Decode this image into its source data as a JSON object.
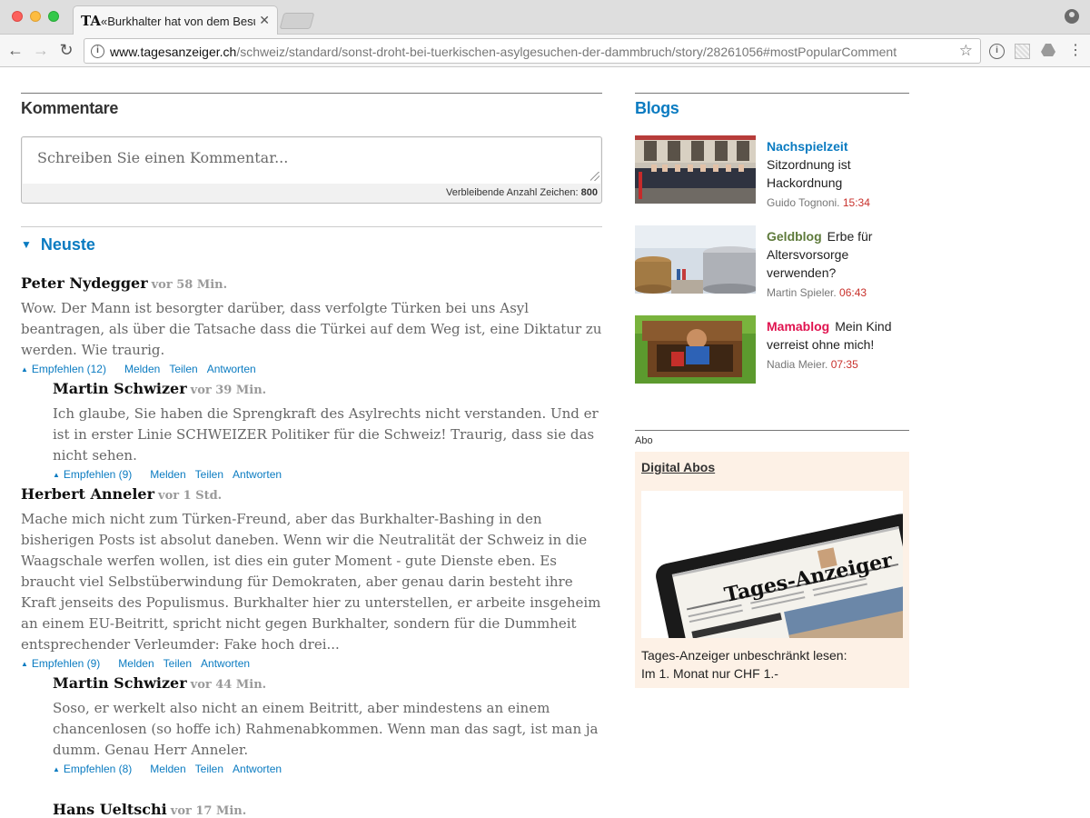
{
  "browser": {
    "tab_title": "«Burkhalter hat von dem Besu",
    "tab_close_icon": "close-icon",
    "url_host": "www.tagesanzeiger.ch",
    "url_path": "/schweiz/standard/sonst-droht-bei-tuerkischen-asylgesuchen-der-dammbruch/story/28261056#mostPopularComment"
  },
  "comments_section": {
    "title": "Kommentare",
    "placeholder": "Schreiben Sie einen Kommentar...",
    "counter_label": "Verbleibende Anzahl Zeichen:",
    "counter_value": "800",
    "sort_label": "Neuste"
  },
  "actions": {
    "reply": "Antworten",
    "report": "Melden",
    "share": "Teilen"
  },
  "comments": [
    {
      "author": "Peter Nydegger",
      "time": "vor 58 Min.",
      "text": "Wow. Der Mann ist besorgter darüber, dass verfolgte Türken bei uns Asyl beantragen, als über die Tatsache dass die Türkei auf dem Weg ist, eine Diktatur zu werden. Wie traurig.",
      "recommend": "Empfehlen (12)"
    },
    {
      "author": "Martin Schwizer",
      "time": "vor 39 Min.",
      "text": "Ich glaube, Sie haben die Sprengkraft des Asylrechts nicht verstanden. Und er ist in erster Linie SCHWEIZER Politiker für die Schweiz! Traurig, dass sie das nicht sehen.",
      "recommend": "Empfehlen (9)"
    },
    {
      "author": "Herbert Anneler",
      "time": "vor 1 Std.",
      "text": "Mache mich nicht zum Türken-Freund, aber das Burkhalter-Bashing in den bisherigen Posts ist absolut daneben. Wenn wir die Neutralität der Schweiz in die Waagschale werfen wollen, ist dies ein guter Moment - gute Dienste eben. Es braucht viel Selbstüberwindung für Demokraten, aber genau darin besteht ihre Kraft jenseits des Populismus. Burkhalter hier zu unterstellen, er arbeite insgeheim an einem EU-Beitritt, spricht nicht gegen Burkhalter, sondern für die Dummheit entsprechender Verleumder: Fake hoch drei...",
      "recommend": "Empfehlen (9)"
    },
    {
      "author": "Martin Schwizer",
      "time": "vor 44 Min.",
      "text": "Soso, er werkelt also nicht an einem Beitritt, aber mindestens an einem chancenlosen (so hoffe ich) Rahmenabkommen. Wenn man das sagt, ist man ja dumm. Genau Herr Anneler.",
      "recommend": "Empfehlen (8)"
    },
    {
      "author": "Hans Ueltschi",
      "time": "vor 17 Min."
    }
  ],
  "sidebar": {
    "blogs_title": "Blogs",
    "blogs": [
      {
        "name": "Nachspielzeit",
        "name_color": "#0a7bc1",
        "headline": "Sitzordnung ist Hackordnung",
        "author": "Guido Tognoni.",
        "time": "15:34"
      },
      {
        "name": "Geldblog",
        "name_color": "#5e7a3b",
        "headline": "Erbe für Altersvorsorge verwenden?",
        "author": "Martin Spieler.",
        "time": "06:43"
      },
      {
        "name": "Mamablog",
        "name_color": "#e0134f",
        "headline": "Mein Kind verreist ohne mich!",
        "author": "Nadia Meier.",
        "time": "07:35"
      }
    ],
    "abo_label": "Abo",
    "abo_title": "Digital Abos",
    "abo_image_logo": "Tages-Anzeiger",
    "abo_text_1": "Tages-Anzeiger unbeschränkt lesen:",
    "abo_text_2": "Im 1. Monat nur CHF 1.-"
  },
  "colors": {
    "accent_blue": "#0a7bc1",
    "time_red": "#c8312c",
    "abo_bg": "#fdf1e6"
  }
}
